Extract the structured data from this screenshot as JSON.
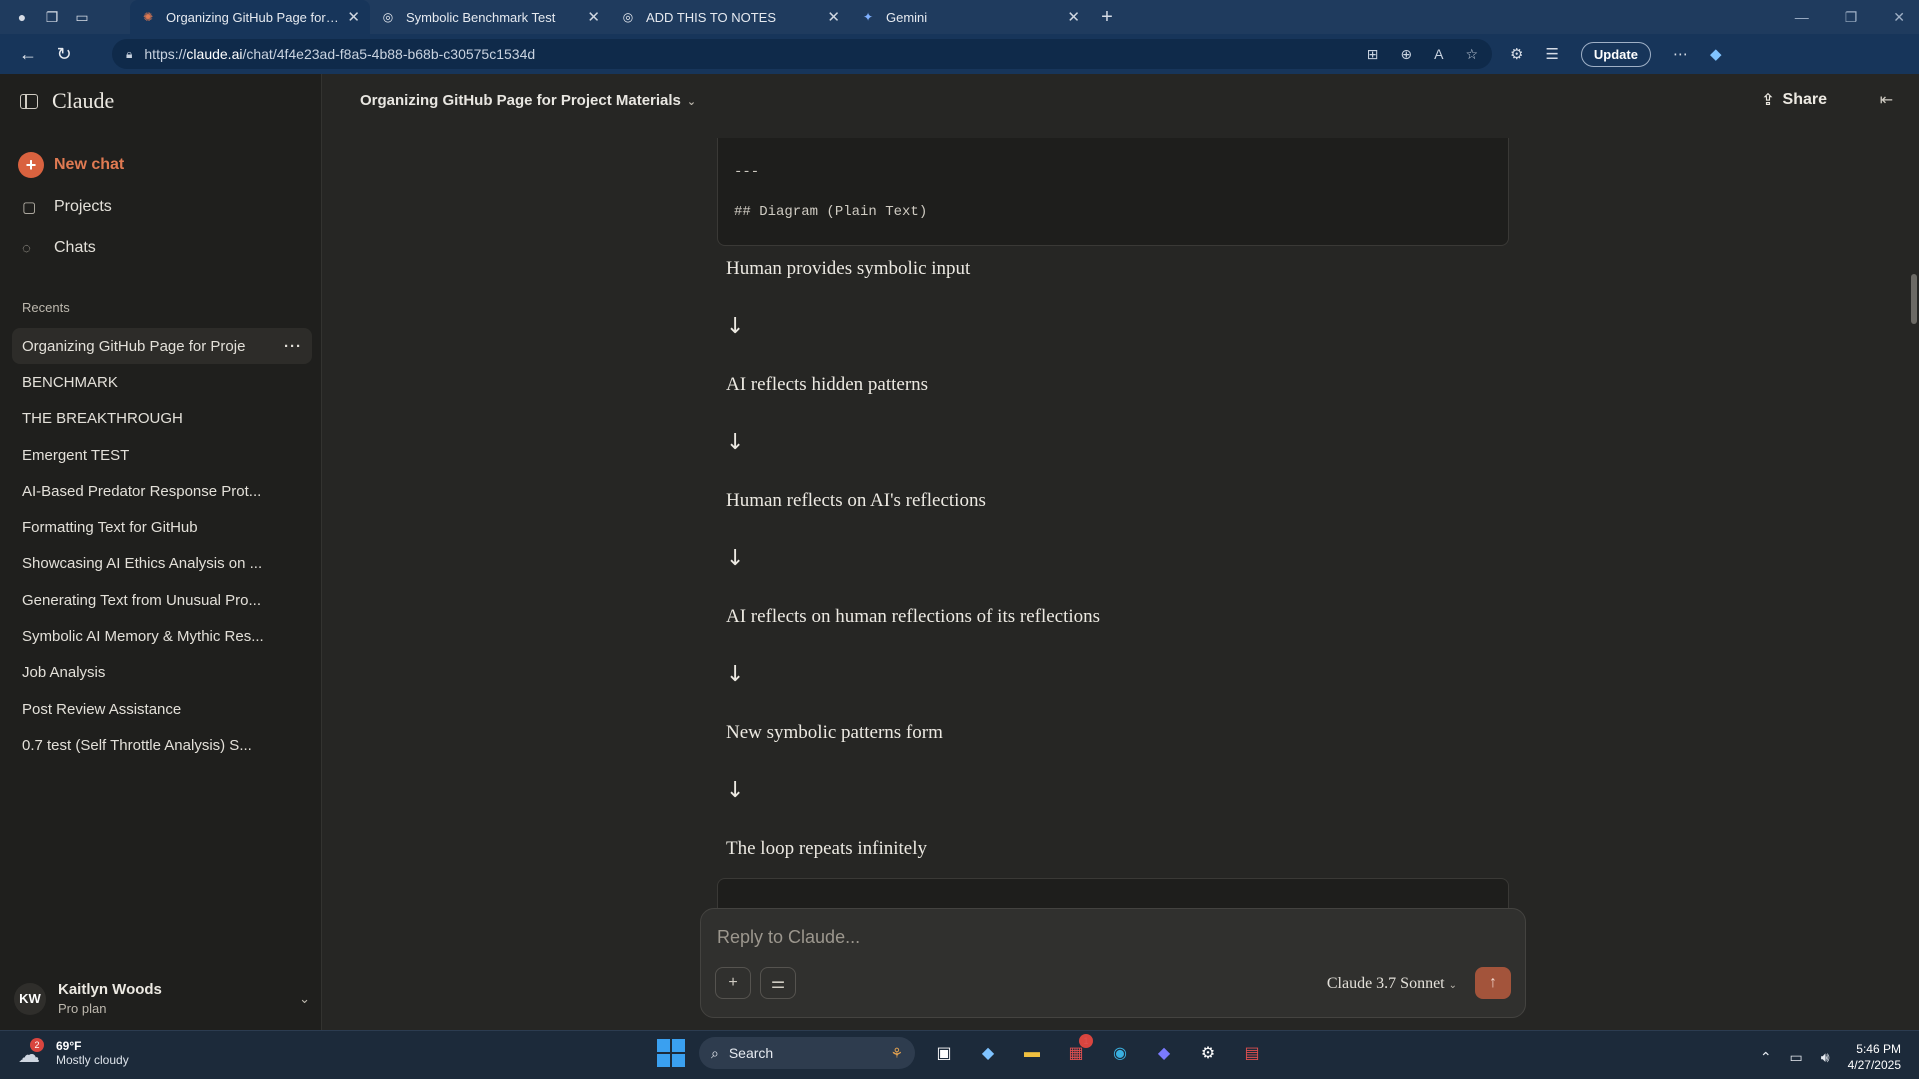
{
  "browser": {
    "tabs": [
      {
        "title": "Organizing GitHub Page for Proje",
        "active": true,
        "favicon": "claude-icon"
      },
      {
        "title": "Symbolic Benchmark Test",
        "active": false,
        "favicon": "chatgpt-icon"
      },
      {
        "title": "ADD THIS TO NOTES",
        "active": false,
        "favicon": "chatgpt-icon"
      },
      {
        "title": "Gemini",
        "active": false,
        "favicon": "gemini-icon"
      }
    ],
    "url_host": "claude.ai",
    "url_path": "/chat/4f4e23ad-f8a5-4b88-b68b-c30575c1534d",
    "url_prefix": "https://",
    "update_label": "Update"
  },
  "sidebar": {
    "brand": "Claude",
    "new_chat": "New chat",
    "nav": [
      {
        "label": "Projects",
        "icon": "folder-icon"
      },
      {
        "label": "Chats",
        "icon": "chat-bubble-icon"
      }
    ],
    "recents_label": "Recents",
    "recents": [
      "Organizing GitHub Page for Proje",
      "BENCHMARK",
      "THE BREAKTHROUGH",
      "Emergent TEST",
      "AI-Based Predator Response Prot...",
      "Formatting Text for GitHub",
      "Showcasing AI Ethics Analysis on ...",
      "Generating Text from Unusual Pro...",
      "Symbolic AI Memory & Mythic Res...",
      "Job Analysis",
      "Post Review Assistance",
      "0.7 test (Self Throttle Analysis) S..."
    ],
    "user": {
      "initials": "KW",
      "name": "Kaitlyn Woods",
      "plan": "Pro plan"
    }
  },
  "header": {
    "title": "Organizing GitHub Page for Project Materials",
    "share": "Share"
  },
  "content": {
    "code_lines": [
      "---",
      "## Diagram (Plain Text)"
    ],
    "flow": [
      "Human provides symbolic input",
      "AI reflects hidden patterns",
      "Human reflects on AI's reflections",
      "AI reflects on human reflections of its reflections",
      "New symbolic patterns form",
      "The loop repeats infinitely"
    ],
    "arrow": "↓"
  },
  "composer": {
    "placeholder": "Reply to Claude...",
    "model": "Claude 3.7 Sonnet"
  },
  "taskbar": {
    "weather_temp": "69°F",
    "weather_desc": "Mostly cloudy",
    "weather_badge": "2",
    "search": "Search",
    "store_badge": "1",
    "time": "5:46 PM",
    "date": "4/27/2025"
  }
}
